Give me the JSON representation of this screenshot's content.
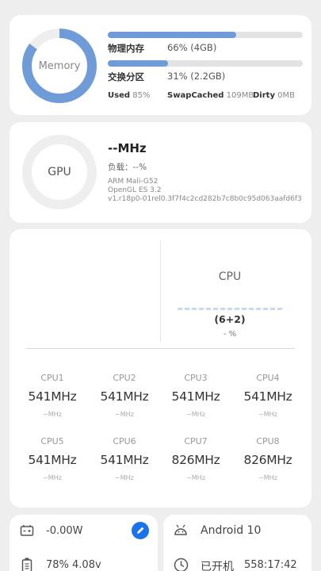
{
  "status_bar": {
    "left": "···",
    "mid": "··"
  },
  "memory": {
    "donut_label": "Memory",
    "used_fraction": 0.85,
    "rows": [
      {
        "label": "物理内存",
        "value": "66% (4GB)",
        "fraction": 0.66
      },
      {
        "label": "交换分区",
        "value": "31% (2.2GB)",
        "fraction": 0.31
      }
    ],
    "footer": {
      "used_label": "Used",
      "used_value": "85%",
      "swapcached_label": "SwapCached",
      "swapcached_value": "109MB",
      "dirty_label": "Dirty",
      "dirty_value": "0MB"
    },
    "accent": "#6f9bd8"
  },
  "gpu": {
    "donut_label": "GPU",
    "freq": "--MHz",
    "load": "负载：--%",
    "renderer": "ARM Mali-G52",
    "api": "OpenGL ES 3.2",
    "driver": "v1.r18p0-01rel0.3f7f4c2cd282b7c8b0c95d063aafd6f3"
  },
  "cpu": {
    "title": "CPU",
    "cores": "(6+2)",
    "percent": "- %",
    "list": [
      {
        "name": "CPU1",
        "freq": "541MHz",
        "range": "~MHz"
      },
      {
        "name": "CPU2",
        "freq": "541MHz",
        "range": "~MHz"
      },
      {
        "name": "CPU3",
        "freq": "541MHz",
        "range": "~MHz"
      },
      {
        "name": "CPU4",
        "freq": "541MHz",
        "range": "~MHz"
      },
      {
        "name": "CPU5",
        "freq": "541MHz",
        "range": "~MHz"
      },
      {
        "name": "CPU6",
        "freq": "541MHz",
        "range": "~MHz"
      },
      {
        "name": "CPU7",
        "freq": "826MHz",
        "range": "~MHz"
      },
      {
        "name": "CPU8",
        "freq": "826MHz",
        "range": "~MHz"
      }
    ]
  },
  "power": {
    "watts": "-0.00W",
    "battery": "78%  4.08v",
    "accent": "#1a73e8"
  },
  "system": {
    "android": "Android 10",
    "uptime_label": "已开机",
    "uptime": "558:17:42"
  }
}
